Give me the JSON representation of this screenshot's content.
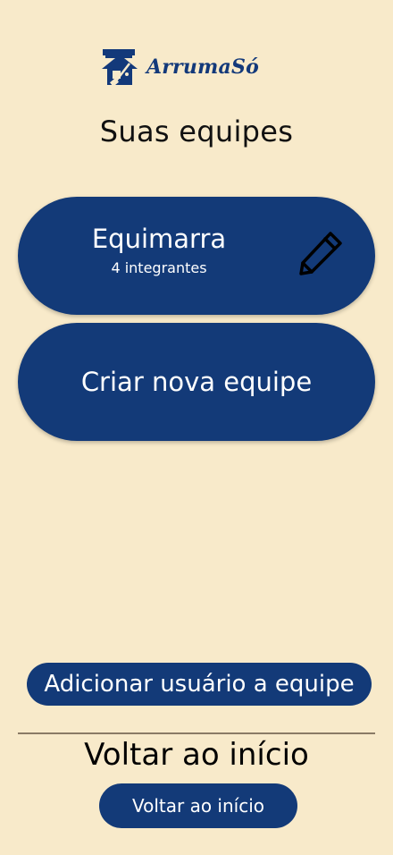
{
  "app": {
    "logo_text": "ArrumaSó"
  },
  "page": {
    "title": "Suas equipes"
  },
  "teams": [
    {
      "name": "Equimarra",
      "member_count": "4 integrantes"
    }
  ],
  "actions": {
    "create_team_label": "Criar nova equipe",
    "add_user_label": "Adicionar usuário a equipe",
    "back_heading": "Voltar ao início",
    "back_button_label": "Voltar ao início"
  },
  "icons": {
    "logo": "house-broom-icon",
    "edit": "pencil-icon"
  },
  "colors": {
    "background": "#f8eaca",
    "primary": "#133a78",
    "text_on_primary": "#ffffff"
  }
}
